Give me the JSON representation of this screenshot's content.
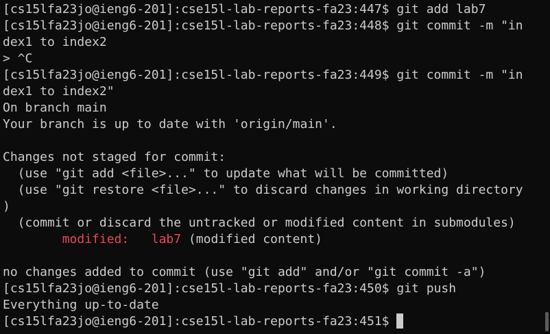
{
  "terminal": {
    "lines": [
      "[cs15lfa23jo@ieng6-201]:cse15l-lab-reports-fa23:447$ git add lab7",
      "[cs15lfa23jo@ieng6-201]:cse15l-lab-reports-fa23:448$ git commit -m \"in",
      "dex1 to index2",
      "> ^C",
      "[cs15lfa23jo@ieng6-201]:cse15l-lab-reports-fa23:449$ git commit -m \"in",
      "dex1 to index2\"",
      "On branch main",
      "Your branch is up to date with 'origin/main'.",
      "",
      "Changes not staged for commit:",
      "  (use \"git add <file>...\" to update what will be committed)",
      "  (use \"git restore <file>...\" to discard changes in working directory",
      ")",
      "  (commit or discard the untracked or modified content in submodules)"
    ],
    "modified_indent": "        ",
    "modified_label": "modified:   lab7",
    "modified_suffix": " (modified content)",
    "lines_after": [
      "",
      "no changes added to commit (use \"git add\" and/or \"git commit -a\")",
      "[cs15lfa23jo@ieng6-201]:cse15l-lab-reports-fa23:450$ git push",
      "Everything up-to-date"
    ],
    "prompt": "[cs15lfa23jo@ieng6-201]:cse15l-lab-reports-fa23:451$ ",
    "colors": {
      "background": "#0c0c0c",
      "foreground": "#cccccc",
      "modified": "#e74856"
    }
  }
}
